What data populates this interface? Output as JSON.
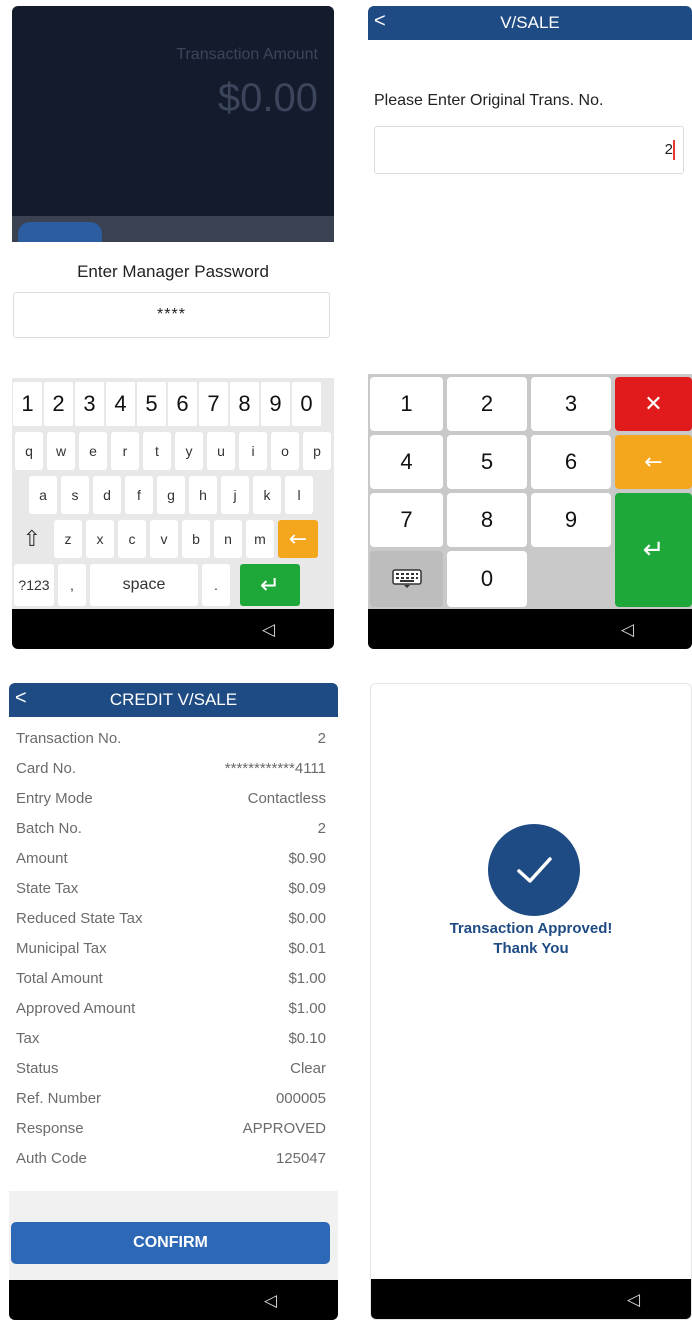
{
  "panel1": {
    "amount_label": "Transaction Amount",
    "amount_value": "$0.00",
    "dialog_title": "Enter Manager Password",
    "password_value": "****",
    "keyboard": {
      "number_row": [
        "1",
        "2",
        "3",
        "4",
        "5",
        "6",
        "7",
        "8",
        "9",
        "0"
      ],
      "row1": [
        "q",
        "w",
        "e",
        "r",
        "t",
        "y",
        "u",
        "i",
        "o",
        "p"
      ],
      "row2": [
        "a",
        "s",
        "d",
        "f",
        "g",
        "h",
        "j",
        "k",
        "l"
      ],
      "row3": [
        "z",
        "x",
        "c",
        "v",
        "b",
        "n",
        "m"
      ],
      "symbols_label": "?123",
      "comma_label": ",",
      "space_label": "space",
      "period_label": ".",
      "shift_glyph": "⇧",
      "backspace_glyph": "←",
      "enter_glyph": "↵"
    },
    "nav_back_glyph": "◁"
  },
  "panel2": {
    "title": "V/SALE",
    "back_glyph": "<",
    "prompt": "Please Enter Original Trans. No.",
    "trans_no_value": "2",
    "keypad": {
      "k1": "1",
      "k2": "2",
      "k3": "3",
      "k4": "4",
      "k5": "5",
      "k6": "6",
      "k7": "7",
      "k8": "8",
      "k9": "9",
      "k0": "0",
      "clear_glyph": "✕",
      "backspace_glyph": "←",
      "enter_glyph": "↵"
    },
    "nav_back_glyph": "◁"
  },
  "panel3": {
    "title": "CREDIT V/SALE",
    "back_glyph": "<",
    "details": [
      {
        "label": "Transaction No.",
        "value": "2"
      },
      {
        "label": "Card No.",
        "value": "************4111"
      },
      {
        "label": "Entry Mode",
        "value": "Contactless"
      },
      {
        "label": "Batch No.",
        "value": "2"
      },
      {
        "label": "Amount",
        "value": "$0.90"
      },
      {
        "label": "State Tax",
        "value": "$0.09"
      },
      {
        "label": "Reduced State Tax",
        "value": "$0.00"
      },
      {
        "label": "Municipal Tax",
        "value": "$0.01"
      },
      {
        "label": "Total Amount",
        "value": "$1.00"
      },
      {
        "label": "Approved Amount",
        "value": "$1.00"
      },
      {
        "label": "Tax",
        "value": "$0.10"
      },
      {
        "label": "Status",
        "value": "Clear"
      },
      {
        "label": "Ref. Number",
        "value": "000005"
      },
      {
        "label": "Response",
        "value": "APPROVED"
      },
      {
        "label": "Auth Code",
        "value": "125047"
      }
    ],
    "confirm_label": "CONFIRM",
    "nav_back_glyph": "◁"
  },
  "panel4": {
    "message_line1": "Transaction Approved!",
    "message_line2": "Thank You",
    "nav_back_glyph": "◁"
  },
  "colors": {
    "brand_blue": "#1f4b84",
    "confirm_blue": "#2c68b6",
    "danger_red": "#e11b1b",
    "warn_orange": "#f4a61d",
    "ok_green": "#1ea83a"
  }
}
